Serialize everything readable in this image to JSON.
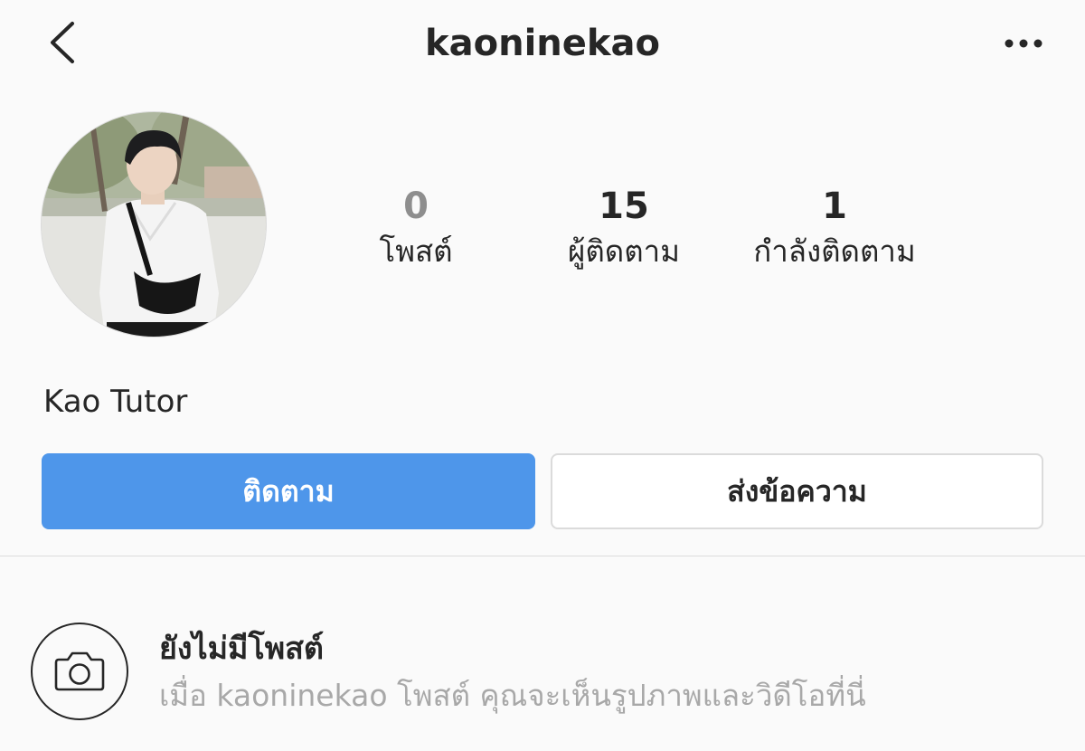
{
  "header": {
    "back_icon": "chevron-left-icon",
    "username": "kaoninekao",
    "more_icon": "more-horizontal-icon"
  },
  "profile": {
    "display_name": "Kao Tutor",
    "stats": {
      "posts": {
        "value": "0",
        "label": "โพสต์"
      },
      "followers": {
        "value": "15",
        "label": "ผู้ติดตาม"
      },
      "following": {
        "value": "1",
        "label": "กำลังติดตาม"
      }
    }
  },
  "actions": {
    "follow_label": "ติดตาม",
    "message_label": "ส่งข้อความ"
  },
  "empty_state": {
    "icon": "camera-icon",
    "title": "ยังไม่มีโพสต์",
    "description": "เมื่อ kaoninekao โพสต์ คุณจะเห็นรูปภาพและวิดีโอที่นี่"
  },
  "colors": {
    "accent": "#4e96ea",
    "text": "#262626",
    "muted": "#a8a8a8",
    "background": "#fafafa"
  }
}
